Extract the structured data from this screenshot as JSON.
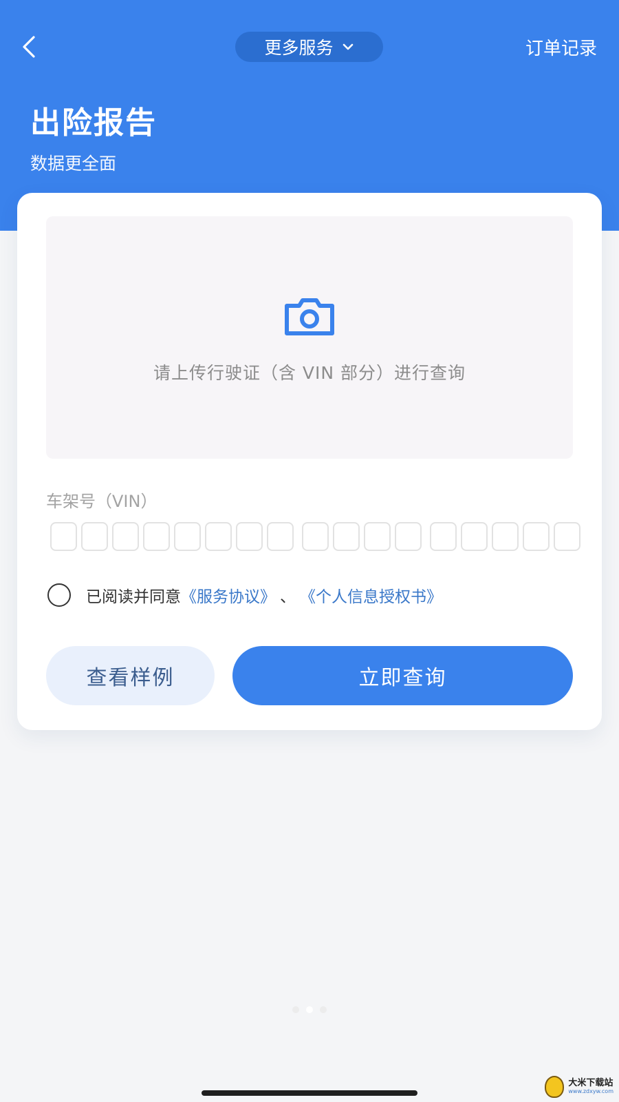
{
  "header": {
    "services_label": "更多服务",
    "order_records": "订单记录",
    "title": "出险报告",
    "subtitle": "数据更全面"
  },
  "upload": {
    "hint": "请上传行驶证（含 VIN 部分）进行查询"
  },
  "vin": {
    "label": "车架号（VIN）",
    "box_count": 17
  },
  "agreement": {
    "prefix": "已阅读并同意",
    "service_agreement": "《服务协议》",
    "separator": "、",
    "privacy_authorization": "《个人信息授权书》",
    "checked": false
  },
  "actions": {
    "sample_label": "查看样例",
    "query_label": "立即查询"
  },
  "watermark": {
    "title": "大米下载站",
    "url": "www.zdxyw.com"
  },
  "colors": {
    "primary": "#3a82ec",
    "pill": "#2b6ed0",
    "link": "#3a78c9"
  },
  "icons": {
    "back": "chevron-left-icon",
    "dropdown": "chevron-down-icon",
    "upload": "camera-icon"
  },
  "pager": {
    "count": 3,
    "active": 1
  }
}
